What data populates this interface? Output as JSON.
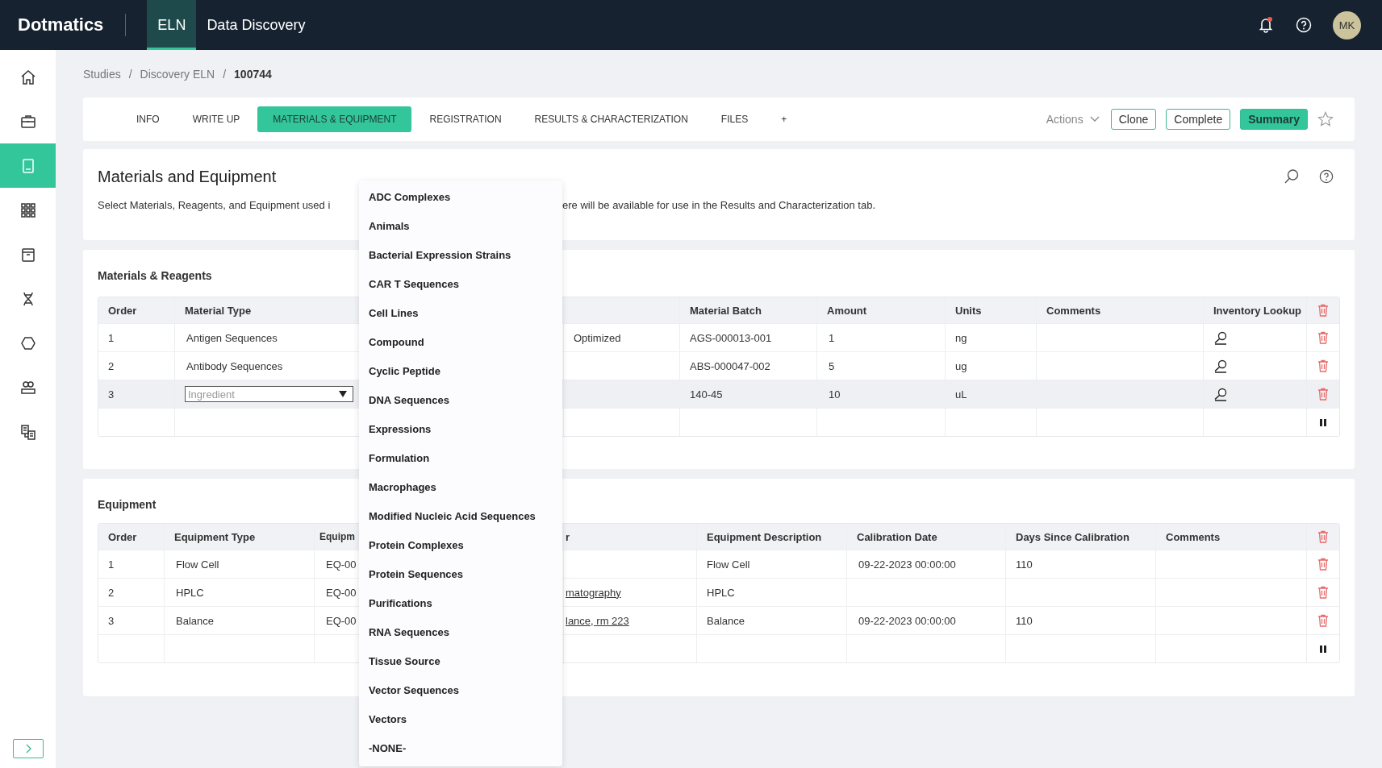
{
  "top_bar": {
    "logo": "Dotmatics",
    "apps": [
      {
        "label": "ELN",
        "selected": true
      },
      {
        "label": "Data Discovery",
        "selected": false
      }
    ],
    "avatar": "MK",
    "notification": true
  },
  "sidebar": {
    "items": [
      {
        "selected": false
      },
      {
        "selected": false
      },
      {
        "selected": true
      },
      {
        "selected": false
      },
      {
        "selected": false
      },
      {
        "selected": false
      },
      {
        "selected": false
      },
      {
        "selected": false
      },
      {
        "selected": false
      }
    ]
  },
  "breadcrumb": {
    "items": [
      "Studies",
      "Discovery ELN",
      "100744"
    ],
    "separators": [
      "/",
      "/"
    ]
  },
  "tabs": [
    {
      "label": "INFO",
      "selected": false
    },
    {
      "label": "WRITE UP",
      "selected": false
    },
    {
      "label": "MATERIALS & EQUIPMENT",
      "selected": true
    },
    {
      "label": "REGISTRATION",
      "selected": false
    },
    {
      "label": "RESULTS & CHARACTERIZATION",
      "selected": false
    },
    {
      "label": "FILES",
      "selected": false
    },
    {
      "label": "+",
      "selected": false
    }
  ],
  "actions": {
    "menu": "Actions",
    "buttons": [
      {
        "label": "Clone",
        "kind": "outline"
      },
      {
        "label": "Complete",
        "kind": "outline"
      },
      {
        "label": "Summary",
        "kind": "filled"
      }
    ],
    "favorite": false
  },
  "intro": {
    "title": "Materials and Equipment",
    "text_left": "Select Materials, Reagents, and Equipment used i",
    "text_right": "ere will be available for use in the Results and Characterization tab."
  },
  "materials": {
    "title": "Materials & Reagents",
    "columns": [
      "Order",
      "Material Type",
      "Material Batch",
      "Amount",
      "Units",
      "Comments",
      "Inventory Lookup"
    ],
    "rows": [
      {
        "order": "1",
        "material_type": {
          "kind": "text",
          "value": "Antigen Sequences"
        },
        "column_4": "Optimized",
        "material_batch": "AGS-000013-001",
        "amount": "1",
        "units": "ng",
        "selected": false
      },
      {
        "order": "2",
        "material_type": {
          "kind": "text",
          "value": "Antibody Sequences"
        },
        "column_4": "",
        "material_batch": "ABS-000047-002",
        "amount": "5",
        "units": "ug",
        "selected": false
      },
      {
        "order": "3",
        "material_type": {
          "kind": "select",
          "placeholder": "Ingredient"
        },
        "column_4": "",
        "material_batch": "140-45",
        "amount": "10",
        "units": "uL",
        "selected": true
      }
    ]
  },
  "equipment": {
    "title": "Equipment",
    "columns": [
      "Order",
      "Equipment Type",
      "Equipm",
      "r",
      "Equipment Description",
      "Calibration Date",
      "Days Since Calibration",
      "Comments"
    ],
    "rows": [
      {
        "order": "1",
        "equipment_type": "Flow Cell",
        "column_3": "EQ-00",
        "column_4": "",
        "description": "Flow Cell",
        "calibration_date": "09-22-2023 00:00:00",
        "days": "110"
      },
      {
        "order": "2",
        "equipment_type": "HPLC",
        "column_3": "EQ-00",
        "column_4": "matography",
        "description": "HPLC",
        "calibration_date": "",
        "days": ""
      },
      {
        "order": "3",
        "equipment_type": "Balance",
        "column_3": "EQ-00",
        "column_4": "lance, rm 223",
        "description": "Balance",
        "calibration_date": "09-22-2023 00:00:00",
        "days": "110"
      }
    ]
  },
  "dropdown": {
    "options": [
      "ADC Complexes",
      "Animals",
      "Bacterial Expression Strains",
      "CAR T Sequences",
      "Cell Lines",
      "Compound",
      "Cyclic Peptide",
      "DNA Sequences",
      "Expressions",
      "Formulation",
      "Macrophages",
      "Modified Nucleic Acid Sequences",
      "Protein Complexes",
      "Protein Sequences",
      "Purifications",
      "RNA Sequences",
      "Tissue Source",
      "Vector Sequences",
      "Vectors",
      "-NONE-"
    ]
  }
}
